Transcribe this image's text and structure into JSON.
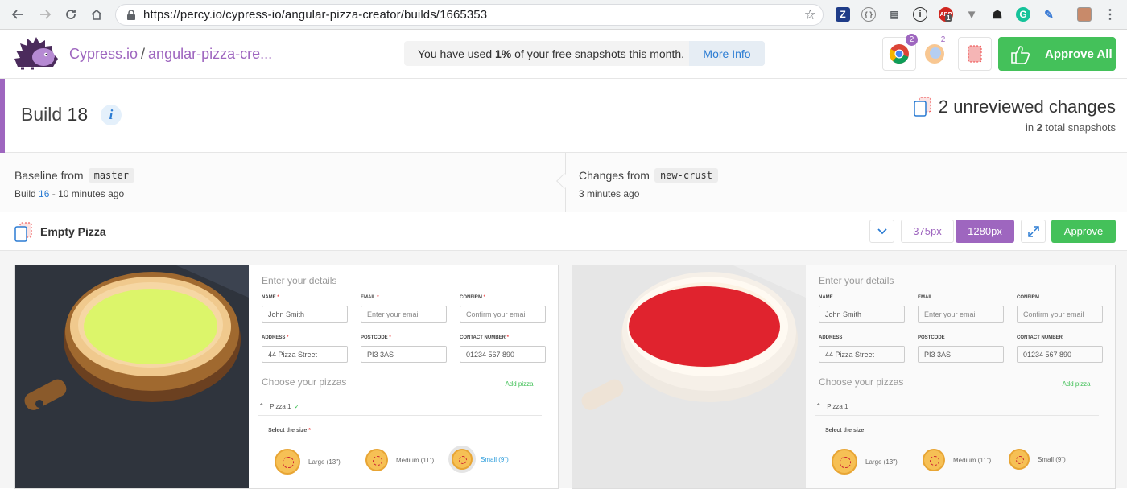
{
  "browser": {
    "url": "https://percy.io/cypress-io/angular-pizza-creator/builds/1665353",
    "extension_badge": "1"
  },
  "header": {
    "org": "Cypress.io",
    "separator": "/",
    "project": "angular-pizza-cre...",
    "quota_prefix": "You have used ",
    "quota_percent": "1%",
    "quota_suffix": " of your free snapshots this month.",
    "more_info": "More Info",
    "chrome_badge": "2",
    "firefox_badge": "2",
    "approve_all": "Approve All"
  },
  "build": {
    "label": "Build",
    "number": "18",
    "info_icon": "i",
    "unreviewed_count": "2",
    "unreviewed_text": "unreviewed changes",
    "in_text": "in",
    "total_count": "2",
    "total_text": "total snapshots"
  },
  "baseline": {
    "label": "Baseline from",
    "branch": "master",
    "build_prefix": "Build",
    "build_link": "16",
    "time": "- 10 minutes ago"
  },
  "changes": {
    "label": "Changes from",
    "branch": "new-crust",
    "time": "3 minutes ago"
  },
  "snapshot": {
    "name": "Empty Pizza",
    "width_375": "375px",
    "width_1280": "1280px",
    "approve": "Approve"
  },
  "form": {
    "details_heading": "Enter your details",
    "name_label": "NAME",
    "name_value": "John Smith",
    "email_label": "EMAIL",
    "email_placeholder": "Enter your email",
    "confirm_label": "CONFIRM",
    "confirm_placeholder": "Confirm your email",
    "address_label": "ADDRESS",
    "address_value": "44 Pizza Street",
    "postcode_label": "POSTCODE",
    "postcode_value": "PI3 3AS",
    "contact_label": "CONTACT NUMBER",
    "contact_value": "01234 567 890",
    "pizzas_heading": "Choose your pizzas",
    "add_pizza": "+ Add pizza",
    "pizza_1": "Pizza 1",
    "check": "✓",
    "select_size": "Select the size",
    "required_mark": "*",
    "sizes": [
      "Large (13\")",
      "Medium (11\")",
      "Small (9\")"
    ]
  },
  "colors": {
    "accent": "#9e66bf",
    "approve_green": "#44c15a",
    "link_blue": "#2b7cd3",
    "baseline_sauce": "#dcf56a",
    "changes_sauce": "#e0232e"
  }
}
